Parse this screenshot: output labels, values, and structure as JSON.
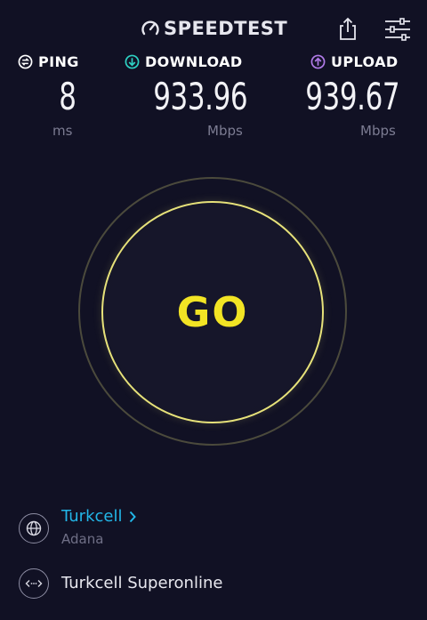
{
  "header": {
    "logo_text": "SPEEDTEST",
    "logo_icon": "speedometer-icon",
    "share_icon": "share-icon",
    "settings_icon": "sliders-icon"
  },
  "metrics": {
    "ping": {
      "label": "PING",
      "value": "8",
      "unit": "ms",
      "icon_color": "#ffffff"
    },
    "download": {
      "label": "DOWNLOAD",
      "value": "933.96",
      "unit": "Mbps",
      "icon_color": "#2ed1c3"
    },
    "upload": {
      "label": "UPLOAD",
      "value": "939.67",
      "unit": "Mbps",
      "icon_color": "#b07ae8"
    }
  },
  "go_button": {
    "label": "GO",
    "color": "#f2e424"
  },
  "provider": {
    "name": "Turkcell",
    "location": "Adana",
    "color": "#22b6e8"
  },
  "server": {
    "name": "Turkcell Superonline"
  }
}
